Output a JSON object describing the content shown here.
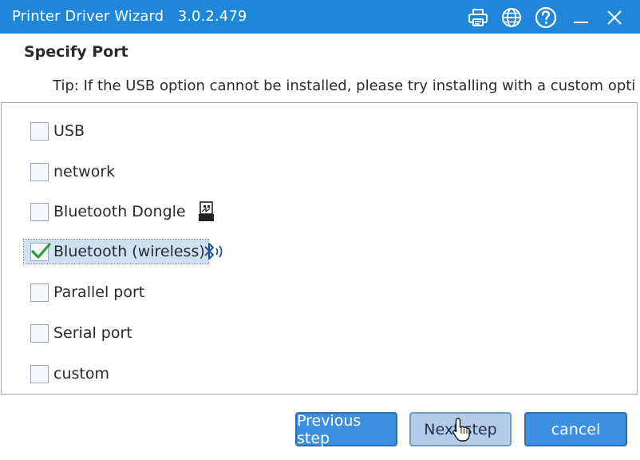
{
  "window": {
    "title": "Printer Driver Wizard",
    "version": "3.0.2.479",
    "accent": "#1f86d8",
    "controls": [
      "printer-icon",
      "globe-icon",
      "help-icon",
      "minimize-icon",
      "close-icon"
    ]
  },
  "header": {
    "heading": "Specify Port",
    "tip": "Tip: If the USB option cannot be installed, please try installing with a custom opti"
  },
  "ports": [
    {
      "label": "USB",
      "checked": false
    },
    {
      "label": "network",
      "checked": false
    },
    {
      "label": "Bluetooth Dongle",
      "checked": false,
      "icon": "usb-dongle-icon"
    },
    {
      "label": "Bluetooth (wireless)",
      "checked": true,
      "icon": "bluetooth-icon"
    },
    {
      "label": "Parallel port",
      "checked": false
    },
    {
      "label": "Serial port",
      "checked": false
    },
    {
      "label": "custom",
      "checked": false
    }
  ],
  "buttons": {
    "previous": "Previous step",
    "next": "Next step",
    "cancel": "cancel"
  }
}
